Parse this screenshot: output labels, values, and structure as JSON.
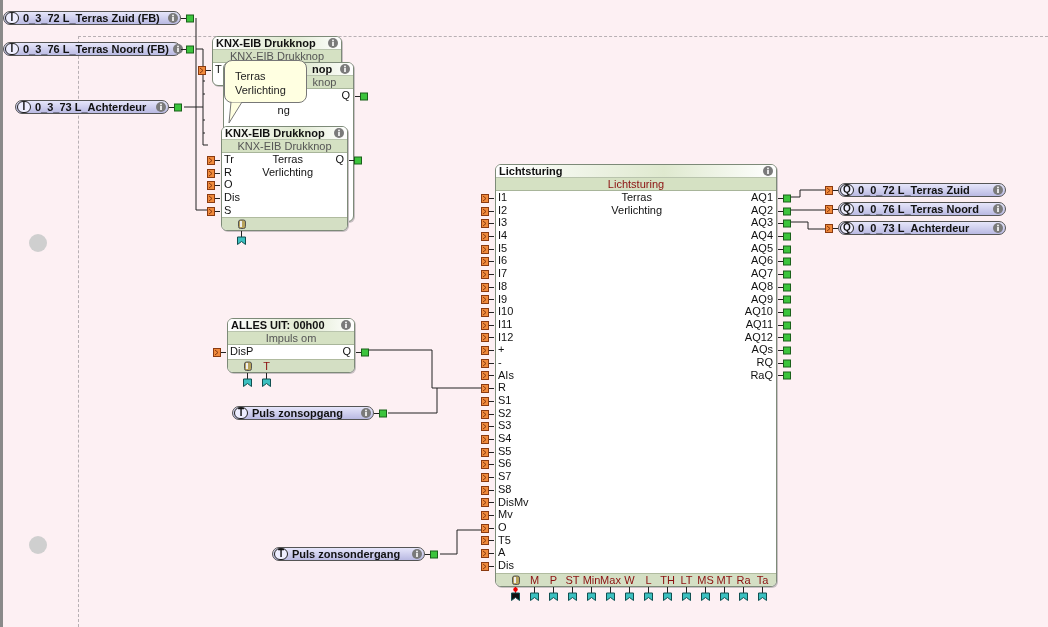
{
  "inputs": [
    {
      "type": "I",
      "name": "0_3_72 L_Terras Zuid (FB)"
    },
    {
      "type": "I",
      "name": "0_3_76 L_Terras Noord (FB)"
    },
    {
      "type": "I",
      "name": "0_3_73 L_Achterdeur"
    }
  ],
  "knx_blocks": [
    {
      "kind": "knx",
      "title": "KNX-EIB Drukknop",
      "subtitle": "KNX-EIB Drukknop",
      "inputs": [
        "T"
      ]
    },
    {
      "kind": "knx",
      "title": "nop",
      "subtitle": "knop",
      "outputs": [
        "Q"
      ],
      "description": "ng"
    },
    {
      "kind": "knx",
      "title": "KNX-EIB Drukknop",
      "subtitle": "KNX-EIB Drukknop",
      "inputs": [
        "Tr",
        "R",
        "O",
        "Dis",
        "S"
      ],
      "outputs": [
        "Q"
      ],
      "description": "Terras Verlichting",
      "gear": true,
      "gear_active": false
    }
  ],
  "tooltip": "Terras Verlichting",
  "timer_block": {
    "kind": "impulse",
    "title": "ALLES UIT: 00h00",
    "subtitle": "Impuls om",
    "inputs": [
      "DisP"
    ],
    "outputs": [
      "Q"
    ],
    "gear": true,
    "gear_active": false,
    "params": [
      "T"
    ]
  },
  "timers": [
    {
      "type": "T",
      "name": "Puls zonsopgang"
    },
    {
      "type": "T",
      "name": "Puls zonsondergang"
    }
  ],
  "light_block": {
    "kind": "lighting",
    "title": "Lichtsturing",
    "subtitle": "Lichtsturing",
    "description": "Terras Verlichting",
    "gear": true,
    "gear_active": true,
    "inputs": [
      "I1",
      "I2",
      "I3",
      "I4",
      "I5",
      "I6",
      "I7",
      "I8",
      "I9",
      "I10",
      "I11",
      "I12",
      "+",
      "-",
      "AIs",
      "R",
      "S1",
      "S2",
      "S3",
      "S4",
      "S5",
      "S6",
      "S7",
      "S8",
      "DisMv",
      "Mv",
      "O",
      "T5",
      "A",
      "Dis"
    ],
    "outputs": [
      "AQ1",
      "AQ2",
      "AQ3",
      "AQ4",
      "AQ5",
      "AQ6",
      "AQ7",
      "AQ8",
      "AQ9",
      "AQ10",
      "AQ11",
      "AQ12",
      "AQs",
      "RQ",
      "RaQ"
    ],
    "params": [
      "M",
      "P",
      "ST",
      "Min",
      "Max",
      "W",
      "L",
      "TH",
      "LT",
      "MS",
      "MT",
      "Ra",
      "Ta"
    ]
  },
  "outputs": [
    {
      "type": "Q",
      "name": "0_0_72 L_Terras Zuid"
    },
    {
      "type": "Q",
      "name": "0_0_76 L_Terras Noord"
    },
    {
      "type": "Q",
      "name": "0_0_73 L_Achterdeur"
    }
  ]
}
